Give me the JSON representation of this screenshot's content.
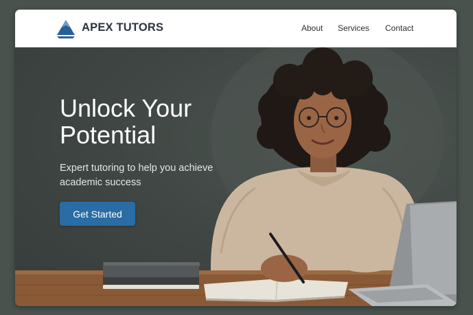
{
  "header": {
    "brand": "APEX TUTORS",
    "logo_icon": "mountain-peak-logo",
    "nav": [
      {
        "label": "About"
      },
      {
        "label": "Services"
      },
      {
        "label": "Contact"
      }
    ]
  },
  "hero": {
    "title": "Unlock Your Potential",
    "subtitle": "Expert tutoring to help you achieve academic success",
    "cta_label": "Get Started",
    "image_subject": "tutor-student-illustration"
  },
  "colors": {
    "accent": "#2a6ca4",
    "header_bg": "#ffffff",
    "hero_bg": "#3f4643",
    "brand_text": "#2b3340"
  }
}
